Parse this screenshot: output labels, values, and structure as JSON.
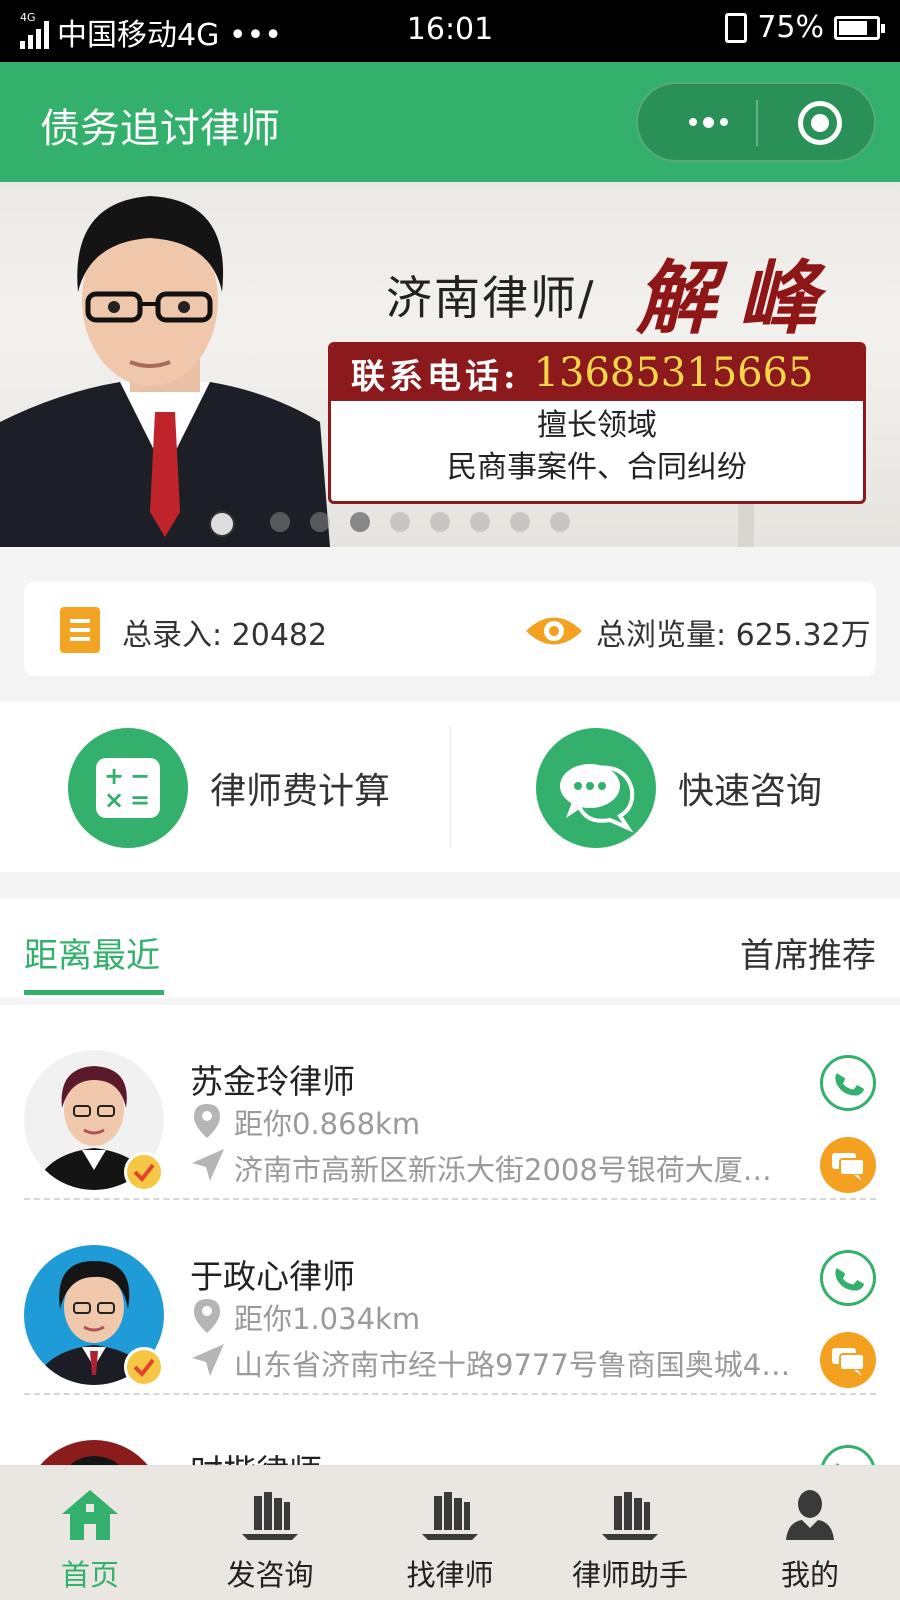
{
  "status_bar": {
    "network_tag": "4G",
    "carrier": "中国移动4G ••• ",
    "time": "16:01",
    "battery": "75%"
  },
  "nav": {
    "title": "债务追讨律师"
  },
  "banner": {
    "title": "济南律师/",
    "name": "解峰",
    "phone_label": "联系电话:",
    "phone": "13685315665",
    "specialty_title": "擅长领域",
    "specialty": "民商事案件、合同纠纷",
    "dots_count": 8,
    "active_dot": 2
  },
  "stats": {
    "entries_label": "总录入:",
    "entries_value": "20482",
    "views_label": "总浏览量:",
    "views_value": "625.32万"
  },
  "actions": {
    "fee_calc": "律师费计算",
    "quick_consult": "快速咨询"
  },
  "tabs": {
    "nearest": "距离最近",
    "recommended": "首席推荐"
  },
  "lawyers": [
    {
      "name": "苏金玲律师",
      "distance": "距你0.868km",
      "address": "济南市高新区新泺大街2008号银荷大厦…"
    },
    {
      "name": "于政心律师",
      "distance": "距你1.034km",
      "address": "山东省济南市经十路9777号鲁商国奥城4…"
    },
    {
      "name": "时楷律师",
      "distance": "",
      "address": ""
    }
  ],
  "bottom_tabs": [
    {
      "label": "首页",
      "icon": "home-icon"
    },
    {
      "label": "发咨询",
      "icon": "books-icon"
    },
    {
      "label": "找律师",
      "icon": "books-icon"
    },
    {
      "label": "律师助手",
      "icon": "books-icon"
    },
    {
      "label": "我的",
      "icon": "user-icon"
    }
  ],
  "colors": {
    "primary_green": "#33b06b",
    "accent_orange": "#f4a020",
    "banner_red": "#8c1a1d"
  }
}
